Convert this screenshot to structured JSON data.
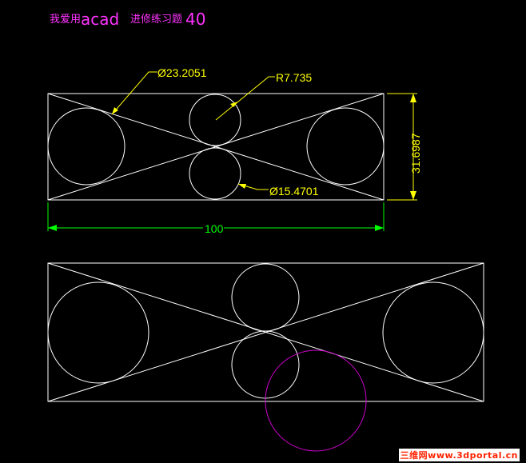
{
  "title": {
    "prefix": "我爱用",
    "app": "acad",
    "suffix": "进修练习题",
    "number": "40",
    "color": "#ff33ff"
  },
  "dimensions": {
    "dia_large": "Ø23.2051",
    "radius_small": "R7.735",
    "dia_small": "Ø15.4701",
    "height": "31.6987",
    "width": "100"
  },
  "colors": {
    "background": "#000000",
    "geometry": "#ffffff",
    "dimension_yellow": "#ffff00",
    "dimension_green": "#00ff00",
    "construction_magenta": "#cc00cc"
  },
  "watermark": "三维网www.3dportal.cn"
}
